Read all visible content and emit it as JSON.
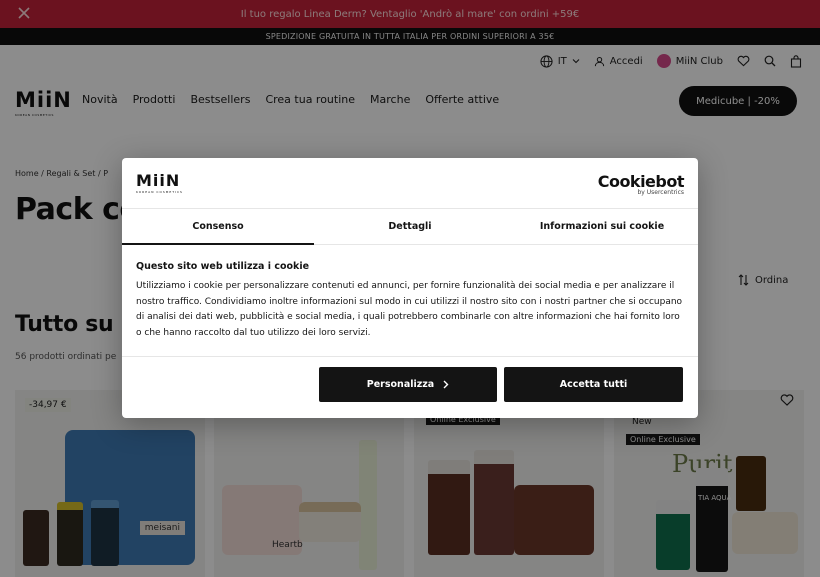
{
  "promo": {
    "text": "Il tuo regalo Linea Derm? Ventaglio 'Andrò al mare' con ordini +59€"
  },
  "shipping_bar": {
    "text": "SPEDIZIONE GRATUITA IN TUTTA ITALIA PER ORDINI SUPERIORI A 35€"
  },
  "utility": {
    "language": "IT",
    "login": "Accedi",
    "club": "MiiN Club"
  },
  "logo": {
    "name": "MiiN",
    "tagline": "KOREAN COSMETICS"
  },
  "nav": {
    "items": [
      "Novità",
      "Prodotti",
      "Bestsellers",
      "Crea tua routine",
      "Marche",
      "Offerte attive"
    ]
  },
  "cta": {
    "label": "Medicube | -20%"
  },
  "breadcrumb": {
    "home": "Home",
    "sep": "/",
    "level2": "Regali & Set",
    "level3": "P"
  },
  "page": {
    "title": "Pack co",
    "sort_label": "Ordina",
    "section_title": "Tutto su P",
    "count": "56 prodotti ordinati pe"
  },
  "products": [
    {
      "discount": "-34,97 €",
      "bag_tag": "meisani"
    },
    {
      "brand": "Heartb"
    },
    {
      "badge": "Online Exclusive"
    },
    {
      "new": "New",
      "badge": "Online Exclusive",
      "brand": "Purit",
      "mini_label": "TIA AQUA"
    }
  ],
  "cookie_modal": {
    "logo_text": "MiiN",
    "logo_sub": "KOREAN COSMETICS",
    "provider": "Cookiebot",
    "provider_sub": "by Usercentrics",
    "tabs": [
      "Consenso",
      "Dettagli",
      "Informazioni sui cookie"
    ],
    "title": "Questo sito web utilizza i cookie",
    "body": "Utilizziamo i cookie per personalizzare contenuti ed annunci, per fornire funzionalità dei social media e per analizzare il nostro traffico. Condividiamo inoltre informazioni sul modo in cui utilizzi il nostro sito con i nostri partner che si occupano di analisi dei dati web, pubblicità e social media, i quali potrebbero combinarle con altre informazioni che hai fornito loro o che hanno raccolto dal tuo utilizzo dei loro servizi.",
    "btn_customize": "Personalizza",
    "btn_accept": "Accetta tutti"
  },
  "colors": {
    "promo_bg": "#c4223a",
    "ship_bg": "#0f0f0f",
    "cta_bg": "#111111",
    "button_bg": "#141414",
    "bag_blue": "#3f7bb5",
    "club_dot": "#d64a8a"
  }
}
